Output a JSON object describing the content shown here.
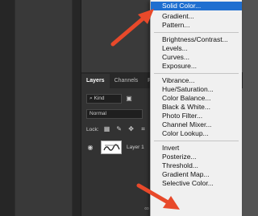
{
  "layers_panel": {
    "tabs": [
      "Layers",
      "Channels",
      "Pa"
    ],
    "filter_kind": "Kind",
    "blend_mode": "Normal",
    "lock_label": "Lock:",
    "layer_name": "Layer 1",
    "bottom_icons": [
      "link-icon",
      "fx-icon",
      "mask-icon",
      "adjustment-icon",
      "group-icon",
      "new-layer-icon",
      "trash-icon"
    ]
  },
  "menu": {
    "groups": [
      [
        "Solid Color...",
        "Gradient...",
        "Pattern..."
      ],
      [
        "Brightness/Contrast...",
        "Levels...",
        "Curves...",
        "Exposure..."
      ],
      [
        "Vibrance...",
        "Hue/Saturation...",
        "Color Balance...",
        "Black & White...",
        "Photo Filter...",
        "Channel Mixer...",
        "Color Lookup..."
      ],
      [
        "Invert",
        "Posterize...",
        "Threshold...",
        "Gradient Map...",
        "Selective Color..."
      ]
    ],
    "selected": "Solid Color..."
  },
  "colors": {
    "menu_highlight": "#1f6fd0",
    "arrow": "#e8492a"
  }
}
